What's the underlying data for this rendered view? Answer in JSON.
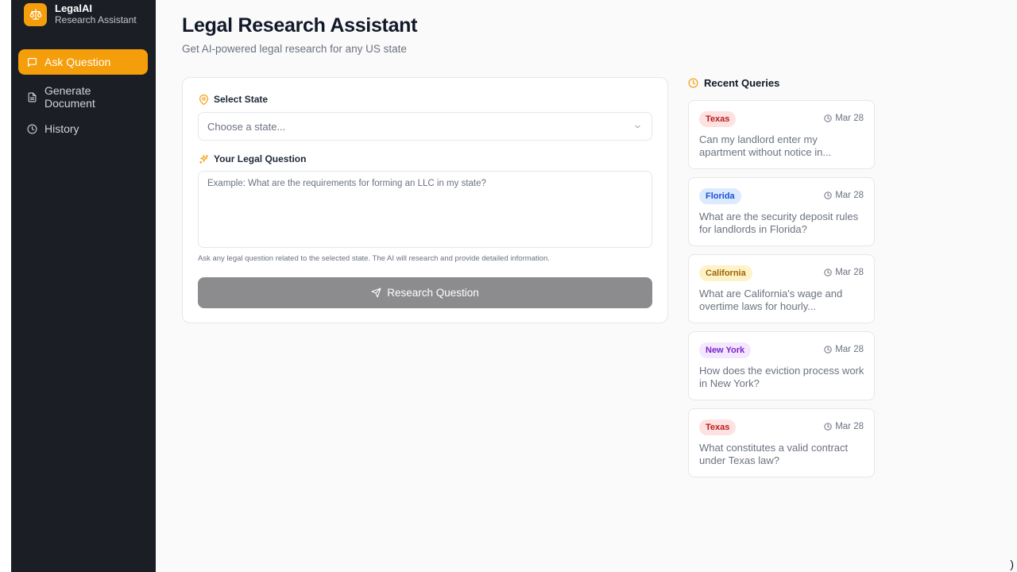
{
  "brand": {
    "name": "LegalAI",
    "subtitle": "Research Assistant",
    "icon": "scale-icon"
  },
  "sidebar": {
    "items": [
      {
        "label": "Ask Question",
        "icon": "message-square-icon",
        "active": true
      },
      {
        "label": "Generate Document",
        "icon": "file-text-icon",
        "active": false
      },
      {
        "label": "History",
        "icon": "clock-icon",
        "active": false
      }
    ]
  },
  "header": {
    "title": "Legal Research Assistant",
    "subtitle": "Get AI-powered legal research for any US state"
  },
  "form": {
    "state_label": "Select State",
    "state_placeholder": "Choose a state...",
    "question_label": "Your Legal Question",
    "question_placeholder": "Example: What are the requirements for forming an LLC in my state?",
    "hint": "Ask any legal question related to the selected state. The AI will research and provide detailed information.",
    "submit_label": "Research Question"
  },
  "recent": {
    "title": "Recent Queries",
    "queries": [
      {
        "state": "Texas",
        "date": "Mar 28",
        "text": "Can my landlord enter my apartment without notice in...",
        "badge_bg": "#fee2e2",
        "badge_fg": "#b91c1c"
      },
      {
        "state": "Florida",
        "date": "Mar 28",
        "text": "What are the security deposit rules for landlords in Florida?",
        "badge_bg": "#dbeafe",
        "badge_fg": "#1d4ed8"
      },
      {
        "state": "California",
        "date": "Mar 28",
        "text": "What are California's wage and overtime laws for hourly...",
        "badge_bg": "#fef3c7",
        "badge_fg": "#a16207"
      },
      {
        "state": "New York",
        "date": "Mar 28",
        "text": "How does the eviction process work in New York?",
        "badge_bg": "#f3e8ff",
        "badge_fg": "#7e22ce"
      },
      {
        "state": "Texas",
        "date": "Mar 28",
        "text": "What constitutes a valid contract under Texas law?",
        "badge_bg": "#fee2e2",
        "badge_fg": "#b91c1c"
      }
    ]
  },
  "colors": {
    "accent": "#f59e0b",
    "sidebar_bg": "#1b1e25",
    "button_disabled": "#8c8c8e"
  }
}
